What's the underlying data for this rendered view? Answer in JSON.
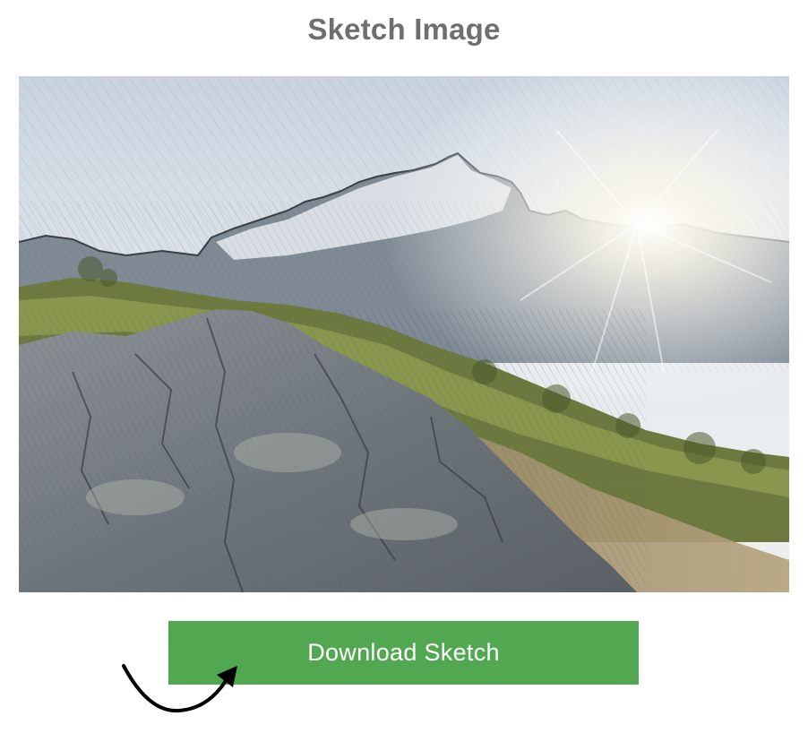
{
  "page": {
    "title": "Sketch Image"
  },
  "image": {
    "name": "pencil-sketch-mountain-landscape"
  },
  "download": {
    "label": "Download Sketch"
  },
  "colors": {
    "title": "#6f6f6f",
    "button": "#52a851",
    "button_text": "#ffffff",
    "arrow": "#000000"
  },
  "icons": {
    "arrow": "curved-arrow-icon"
  }
}
